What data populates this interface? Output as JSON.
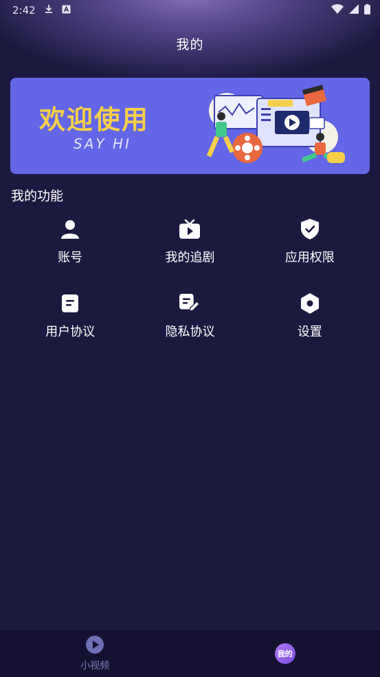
{
  "status_bar": {
    "time": "2:42"
  },
  "header": {
    "title": "我的"
  },
  "banner": {
    "title": "欢迎使用",
    "subtitle": "SAY HI"
  },
  "section": {
    "title": "我的功能"
  },
  "features": [
    {
      "label": "账号",
      "icon": "person-icon"
    },
    {
      "label": "我的追剧",
      "icon": "tv-icon"
    },
    {
      "label": "应用权限",
      "icon": "shield-check-icon"
    },
    {
      "label": "用户协议",
      "icon": "document-icon"
    },
    {
      "label": "隐私协议",
      "icon": "document-edit-icon"
    },
    {
      "label": "设置",
      "icon": "hexagon-settings-icon"
    }
  ],
  "bottom_nav": {
    "tabs": [
      {
        "label": "小视频",
        "icon": "play-circle-icon"
      },
      {
        "label": "我的",
        "icon": "me-badge-icon"
      }
    ]
  },
  "colors": {
    "background": "#1b1940",
    "banner": "#6366e6",
    "banner_title": "#f5cf4a",
    "nav_label": "#7b7bc0",
    "me_badge": "#9b62ec"
  }
}
